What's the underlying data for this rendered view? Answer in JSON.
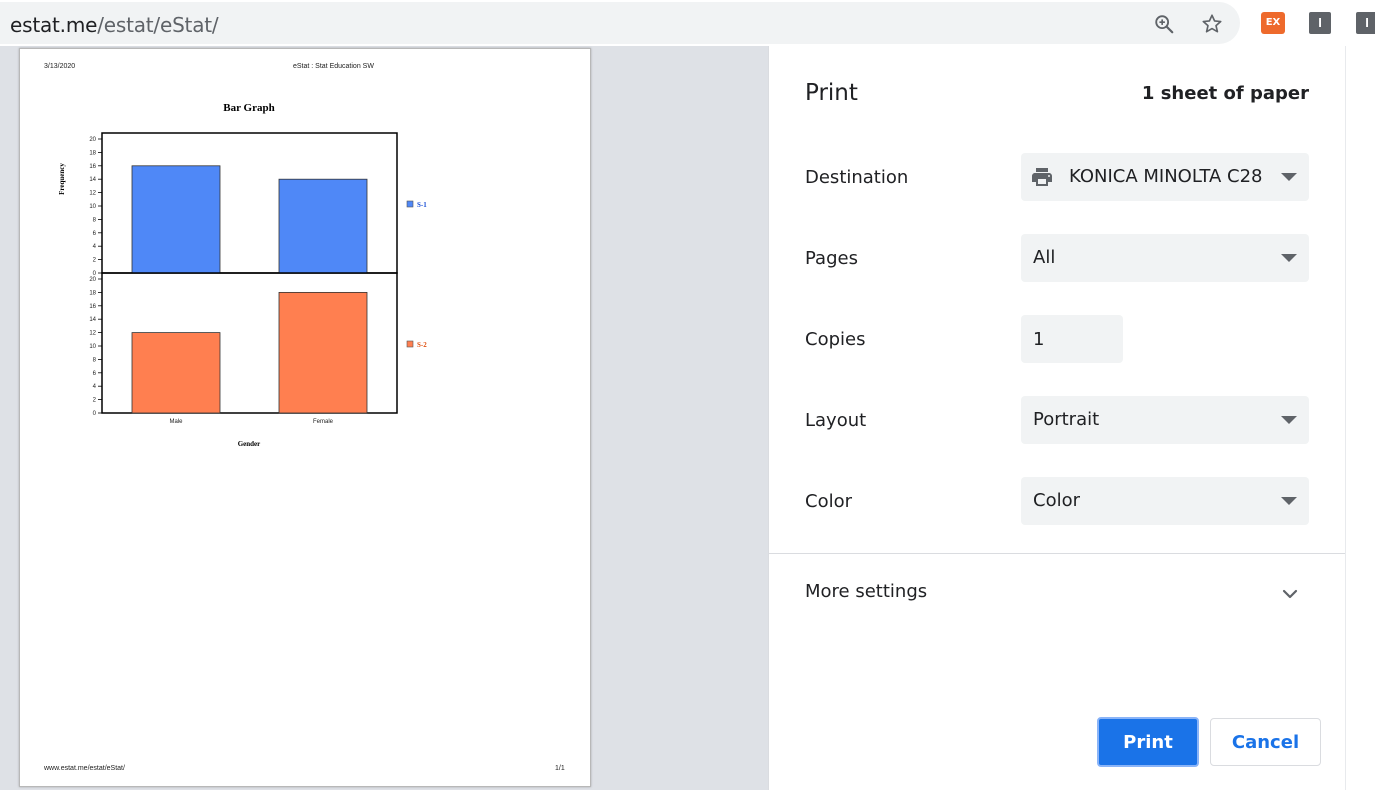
{
  "browser": {
    "url_host": "estat.me",
    "url_path": "/estat/eStat/",
    "extensions": [
      {
        "name": "ex-extension",
        "label": "EX",
        "color": "#ee6a2c"
      },
      {
        "name": "extension-2",
        "label": "I",
        "color": "#5f6368"
      },
      {
        "name": "extension-3",
        "label": "I",
        "color": "#5f6368"
      }
    ]
  },
  "preview": {
    "header_date": "3/13/2020",
    "header_title": "eStat : Stat Education SW",
    "footer_url": "www.estat.me/estat/eStat/",
    "footer_page": "1/1"
  },
  "chart_data": {
    "type": "bar",
    "title": "Bar Graph",
    "xlabel": "Gender",
    "ylabel": "Frequency",
    "categories": [
      "Male",
      "Female"
    ],
    "ylim": [
      0,
      20
    ],
    "yticks": [
      "0",
      "2",
      "4",
      "6",
      "8",
      "10",
      "12",
      "14",
      "16",
      "18",
      "20"
    ],
    "panels": [
      {
        "name": "S-1",
        "color": "#4f88f7",
        "label_color": "#1a4fd6",
        "values": [
          16,
          14
        ]
      },
      {
        "name": "S-2",
        "color": "#ff7f50",
        "label_color": "#e05010",
        "values": [
          12,
          18
        ]
      }
    ]
  },
  "panel": {
    "title": "Print",
    "sheet_count": "1 sheet of paper",
    "destination_label": "Destination",
    "destination_value": "KONICA MINOLTA C28",
    "pages_label": "Pages",
    "pages_value": "All",
    "copies_label": "Copies",
    "copies_value": "1",
    "layout_label": "Layout",
    "layout_value": "Portrait",
    "color_label": "Color",
    "color_value": "Color",
    "more_settings_label": "More settings",
    "print_button": "Print",
    "cancel_button": "Cancel"
  }
}
